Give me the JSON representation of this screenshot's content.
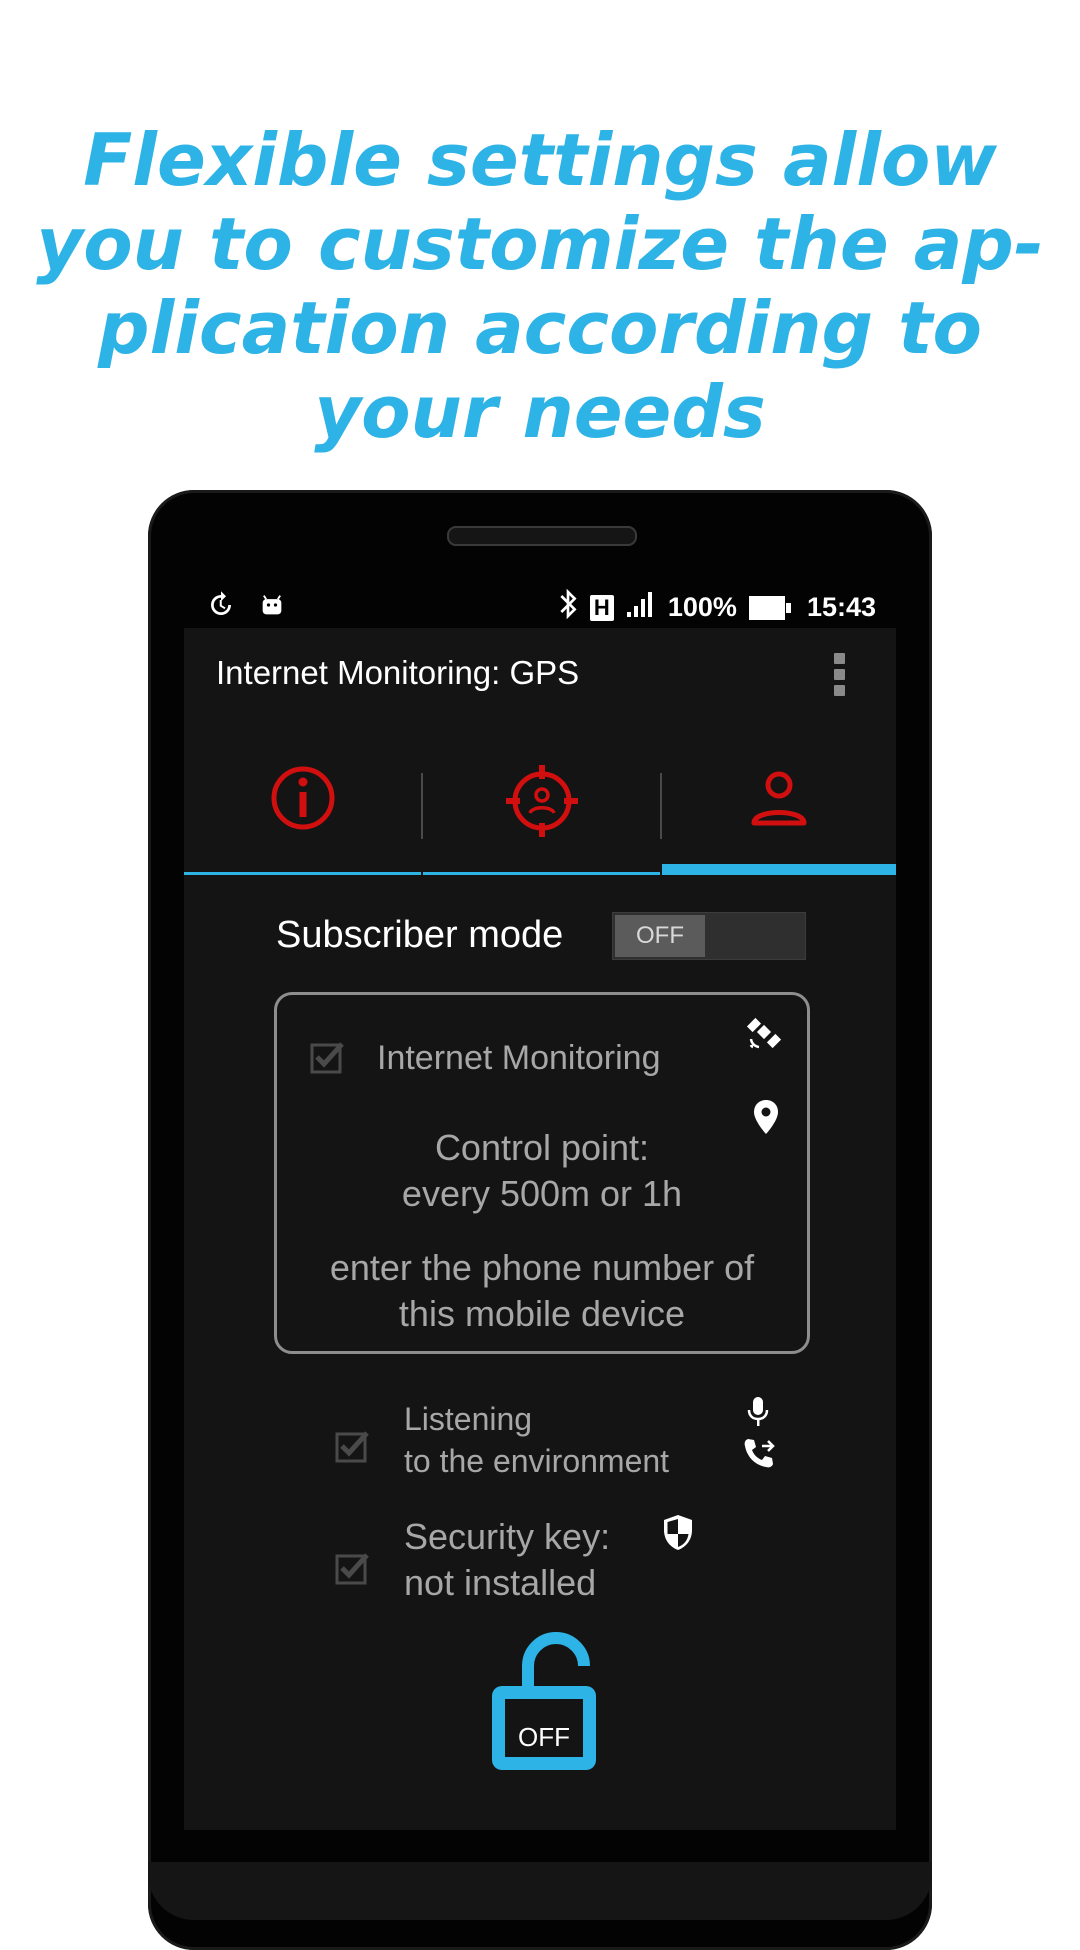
{
  "headline": {
    "line1": "Flexible settings allow",
    "line2": "you to customize the ap-",
    "line3": "plication according to",
    "line4": "your needs"
  },
  "status_bar": {
    "network": "H",
    "battery": "100%",
    "time": "15:43"
  },
  "app": {
    "title": "Internet Monitoring: GPS",
    "tabs": [
      {
        "icon": "info-icon",
        "active": false
      },
      {
        "icon": "target-person-icon",
        "active": false
      },
      {
        "icon": "person-icon",
        "active": true
      }
    ],
    "subscriber_mode": {
      "label": "Subscriber mode",
      "toggle_value": "OFF"
    },
    "monitoring_card": {
      "checkbox_checked": true,
      "title": "Internet Monitoring",
      "control_point_line1": "Control point:",
      "control_point_line2": "every 500m or 1h",
      "hint_line1": "enter the phone number of",
      "hint_line2": "this mobile device"
    },
    "listening": {
      "checked": true,
      "line1": "Listening",
      "line2": "to the environment"
    },
    "security": {
      "checked": true,
      "line1": "Security key:",
      "line2": "not installed"
    },
    "lock_button": {
      "label": "OFF"
    }
  },
  "colors": {
    "accent": "#2eb3e6",
    "tab_icon": "#d10f0f",
    "screen_bg": "#141414",
    "muted_text": "#a7a7a7"
  }
}
